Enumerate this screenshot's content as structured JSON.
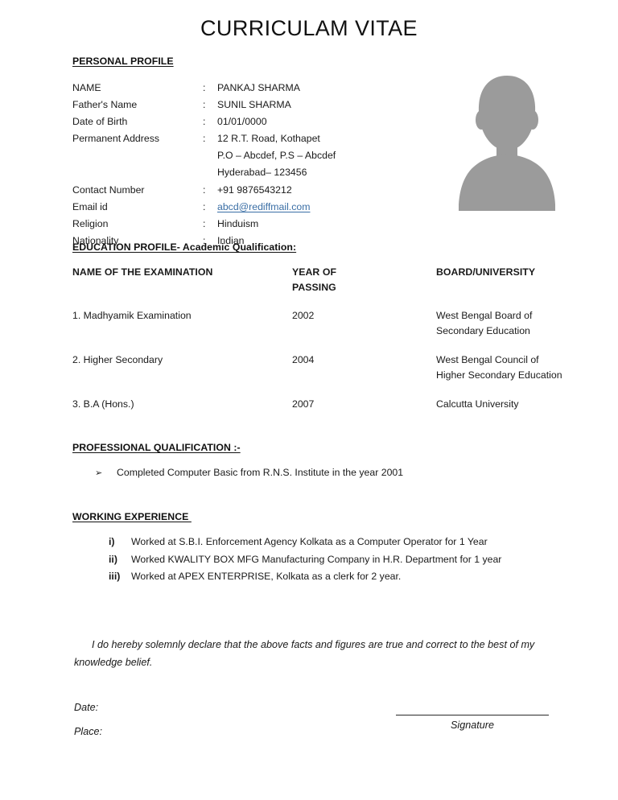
{
  "document": {
    "title": "CURRICULAM VITAE"
  },
  "sections": {
    "personal_profile": {
      "heading": "PERSONAL PROFILE",
      "rows": [
        {
          "label": "NAME",
          "colon": ":",
          "value": "PANKAJ SHARMA"
        },
        {
          "label": "Father's Name",
          "colon": ":",
          "value": "SUNIL SHARMA"
        },
        {
          "label": "Date of Birth",
          "colon": ":",
          "value": "01/01/0000"
        },
        {
          "label": "Permanent Address",
          "colon": ":",
          "value": "12 R.T. Road, Kothapet"
        },
        {
          "label": "",
          "colon": "",
          "value": "P.O – Abcdef, P.S – Abcdef"
        },
        {
          "label": "",
          "colon": "",
          "value": "Hyderabad– 123456"
        },
        {
          "label": "Contact Number",
          "colon": ":",
          "value": "+91 9876543212"
        },
        {
          "label": "Email id",
          "colon": ":",
          "value": "abcd@rediffmail.com",
          "is_link": true
        },
        {
          "label": "Religion",
          "colon": ":",
          "value": "Hinduism"
        },
        {
          "label": "Nationality",
          "colon": ":",
          "value": "Indian"
        }
      ]
    },
    "education": {
      "heading": "EDUCATION PROFILE- Academic Qualification:",
      "columns": [
        "NAME OF THE EXAMINATION",
        "YEAR OF PASSING",
        "BOARD/UNIVERSITY"
      ],
      "column_header_line1": [
        "NAME OF THE EXAMINATION",
        "YEAR OF",
        "BOARD/UNIVERSITY"
      ],
      "column_header_line2": [
        "",
        "PASSING",
        ""
      ],
      "rows": [
        {
          "examination": "1. Madhyamik Examination",
          "year": "2002",
          "board_line1": "West Bengal Board of",
          "board_line2": "Secondary Education"
        },
        {
          "examination": "2. Higher Secondary",
          "year": "2004",
          "board_line1": "West Bengal Council of",
          "board_line2": "Higher Secondary Education"
        },
        {
          "examination": "3. B.A (Hons.)",
          "year": "2007",
          "board_line1": "Calcutta University",
          "board_line2": ""
        }
      ]
    },
    "professional_qualification": {
      "heading": "PROFESSIONAL QUALIFICATION :-",
      "bullet_glyph": "➢",
      "items": [
        "Completed Computer Basic from R.N.S. Institute in the year 2001"
      ]
    },
    "working_experience": {
      "heading": "WORKING EXPERIENCE ",
      "items": [
        {
          "marker": "i)",
          "text": "Worked at S.B.I. Enforcement Agency Kolkata as a Computer Operator for 1 Year"
        },
        {
          "marker": "ii)",
          "text": "Worked KWALITY BOX MFG Manufacturing Company in H.R. Department for 1 year"
        },
        {
          "marker": "iii)",
          "text": "Worked at APEX ENTERPRISE, Kolkata as a clerk for 2 year."
        }
      ]
    },
    "declaration": {
      "text": "I do hereby solemnly declare that the above facts and figures are true and correct to the best of my knowledge belief."
    },
    "footer": {
      "date_label": "Date:",
      "place_label": "Place:",
      "signature_label": "Signature"
    }
  },
  "photo": {
    "icon": "person-silhouette-icon",
    "color": "#9b9b9b",
    "background": "#ffffff"
  },
  "colors": {
    "text": "#1a1a1a",
    "link": "#3a6ea5",
    "rule": "#2a2a2a",
    "page_background": "#ffffff"
  }
}
